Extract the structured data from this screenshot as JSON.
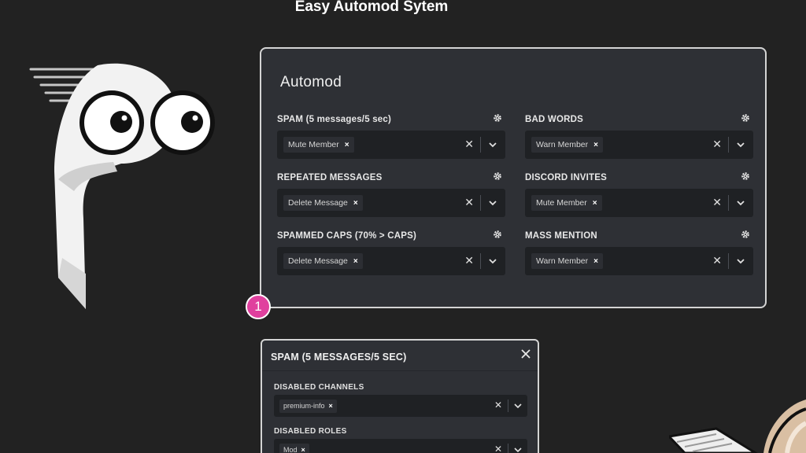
{
  "page": {
    "title": "Easy Automod Sytem"
  },
  "automod": {
    "title": "Automod",
    "rules": [
      {
        "label": "SPAM (5 messages/5 sec)",
        "action": "Mute Member"
      },
      {
        "label": "BAD WORDS",
        "action": "Warn Member"
      },
      {
        "label": "REPEATED MESSAGES",
        "action": "Delete Message"
      },
      {
        "label": "DISCORD INVITES",
        "action": "Mute Member"
      },
      {
        "label": "SPAMMED CAPS (70% > CAPS)",
        "action": "Delete Message"
      },
      {
        "label": "MASS MENTION",
        "action": "Warn Member"
      }
    ],
    "chip_remove": "×",
    "clear_glyph": "✕"
  },
  "step_badge": "1",
  "spam_settings": {
    "title": "SPAM (5 MESSAGES/5 SEC)",
    "disabled_channels": {
      "label": "DISABLED CHANNELS",
      "value": "premium-info"
    },
    "disabled_roles": {
      "label": "DISABLED ROLES",
      "value": "Mod"
    }
  },
  "colors": {
    "background": "#222222",
    "panel": "#2e3035",
    "input": "#1f2124",
    "chip": "#2c2e33",
    "badge": "#e0409e"
  },
  "icons": [
    "gear-icon",
    "chevron-down-icon",
    "clear-icon",
    "close-icon",
    "mascot-logo"
  ]
}
